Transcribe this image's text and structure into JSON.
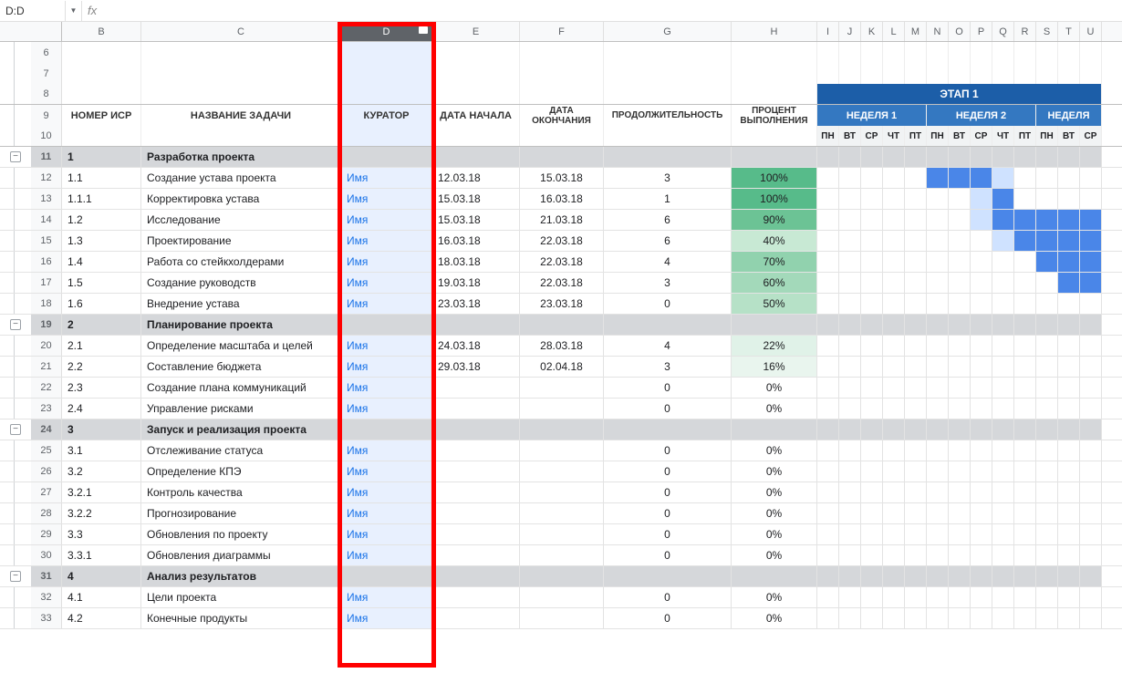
{
  "name_box": "D:D",
  "fx_label": "fx",
  "columns": [
    "B",
    "C",
    "D",
    "E",
    "F",
    "G",
    "H",
    "I",
    "J",
    "K",
    "L",
    "M",
    "N",
    "O",
    "P",
    "Q",
    "R",
    "S",
    "T",
    "U"
  ],
  "col_widths": [
    "w-b",
    "w-c",
    "w-d",
    "w-e",
    "w-f",
    "w-g",
    "w-h",
    "w-day",
    "w-day",
    "w-day",
    "w-day",
    "w-day",
    "w-day",
    "w-day",
    "w-day",
    "w-day",
    "w-day",
    "w-day",
    "w-day",
    "w-day"
  ],
  "selected_col": "D",
  "headers": {
    "b": "НОМЕР ИСР",
    "c": "НАЗВАНИЕ ЗАДАЧИ",
    "d": "КУРАТОР",
    "e": "ДАТА НАЧАЛА",
    "f": "ДАТА ОКОНЧАНИЯ",
    "g": "ПРОДОЛЖИТЕЛЬНОСТЬ",
    "h": "ПРОЦЕНТ ВЫПОЛНЕНИЯ",
    "stage": "ЭТАП 1",
    "week1": "НЕДЕЛЯ 1",
    "week2": "НЕДЕЛЯ 2",
    "week3": "НЕДЕЛЯ",
    "days": [
      "ПН",
      "ВТ",
      "СР",
      "ЧТ",
      "ПТ",
      "ПН",
      "ВТ",
      "СР",
      "ЧТ",
      "ПТ",
      "ПН",
      "ВТ",
      "СР"
    ]
  },
  "rows": [
    {
      "n": 6,
      "type": "blank"
    },
    {
      "n": 7,
      "type": "blank"
    },
    {
      "n": 8,
      "type": "header8"
    },
    {
      "n": 9,
      "type": "header9"
    },
    {
      "n": 10,
      "type": "header10"
    },
    {
      "n": 11,
      "type": "section",
      "wbs": "1",
      "title": "Разработка проекта",
      "toggle": true
    },
    {
      "n": 12,
      "type": "task",
      "wbs": "1.1",
      "title": "Создание устава проекта",
      "cur": "Имя",
      "start": "12.03.18",
      "end": "15.03.18",
      "dur": "3",
      "pct": "100%",
      "pcls": "g100",
      "gantt": [
        0,
        0,
        0,
        0,
        0,
        2,
        2,
        2,
        1,
        0,
        0,
        0,
        0
      ]
    },
    {
      "n": 13,
      "type": "task",
      "wbs": "1.1.1",
      "title": "Корректировка устава",
      "cur": "Имя",
      "start": "15.03.18",
      "end": "16.03.18",
      "dur": "1",
      "pct": "100%",
      "pcls": "g100",
      "gantt": [
        0,
        0,
        0,
        0,
        0,
        0,
        0,
        1,
        2,
        0,
        0,
        0,
        0
      ]
    },
    {
      "n": 14,
      "type": "task",
      "wbs": "1.2",
      "title": "Исследование",
      "cur": "Имя",
      "start": "15.03.18",
      "end": "21.03.18",
      "dur": "6",
      "pct": "90%",
      "pcls": "g90",
      "gantt": [
        0,
        0,
        0,
        0,
        0,
        0,
        0,
        1,
        2,
        2,
        2,
        2,
        2
      ]
    },
    {
      "n": 15,
      "type": "task",
      "wbs": "1.3",
      "title": "Проектирование",
      "cur": "Имя",
      "start": "16.03.18",
      "end": "22.03.18",
      "dur": "6",
      "pct": "40%",
      "pcls": "g40",
      "gantt": [
        0,
        0,
        0,
        0,
        0,
        0,
        0,
        0,
        1,
        2,
        2,
        2,
        2
      ]
    },
    {
      "n": 16,
      "type": "task",
      "wbs": "1.4",
      "title": "Работа со стейкхолдерами",
      "cur": "Имя",
      "start": "18.03.18",
      "end": "22.03.18",
      "dur": "4",
      "pct": "70%",
      "pcls": "g70",
      "gantt": [
        0,
        0,
        0,
        0,
        0,
        0,
        0,
        0,
        0,
        0,
        2,
        2,
        2
      ]
    },
    {
      "n": 17,
      "type": "task",
      "wbs": "1.5",
      "title": "Создание руководств",
      "cur": "Имя",
      "start": "19.03.18",
      "end": "22.03.18",
      "dur": "3",
      "pct": "60%",
      "pcls": "g60",
      "gantt": [
        0,
        0,
        0,
        0,
        0,
        0,
        0,
        0,
        0,
        0,
        0,
        2,
        2
      ]
    },
    {
      "n": 18,
      "type": "task",
      "wbs": "1.6",
      "title": "Внедрение устава",
      "cur": "Имя",
      "start": "23.03.18",
      "end": "23.03.18",
      "dur": "0",
      "pct": "50%",
      "pcls": "g50",
      "gantt": [
        0,
        0,
        0,
        0,
        0,
        0,
        0,
        0,
        0,
        0,
        0,
        0,
        0
      ]
    },
    {
      "n": 19,
      "type": "section",
      "wbs": "2",
      "title": "Планирование проекта",
      "toggle": true
    },
    {
      "n": 20,
      "type": "task",
      "wbs": "2.1",
      "title": "Определение масштаба и целей",
      "cur": "Имя",
      "start": "24.03.18",
      "end": "28.03.18",
      "dur": "4",
      "pct": "22%",
      "pcls": "g22",
      "gantt": [
        0,
        0,
        0,
        0,
        0,
        0,
        0,
        0,
        0,
        0,
        0,
        0,
        0
      ]
    },
    {
      "n": 21,
      "type": "task",
      "wbs": "2.2",
      "title": "Составление бюджета",
      "cur": "Имя",
      "start": "29.03.18",
      "end": "02.04.18",
      "dur": "3",
      "pct": "16%",
      "pcls": "g16",
      "gantt": [
        0,
        0,
        0,
        0,
        0,
        0,
        0,
        0,
        0,
        0,
        0,
        0,
        0
      ]
    },
    {
      "n": 22,
      "type": "task",
      "wbs": "2.3",
      "title": "Создание плана коммуникаций",
      "cur": "Имя",
      "start": "",
      "end": "",
      "dur": "0",
      "pct": "0%",
      "pcls": "",
      "gantt": [
        0,
        0,
        0,
        0,
        0,
        0,
        0,
        0,
        0,
        0,
        0,
        0,
        0
      ]
    },
    {
      "n": 23,
      "type": "task",
      "wbs": "2.4",
      "title": "Управление рисками",
      "cur": "Имя",
      "start": "",
      "end": "",
      "dur": "0",
      "pct": "0%",
      "pcls": "",
      "gantt": [
        0,
        0,
        0,
        0,
        0,
        0,
        0,
        0,
        0,
        0,
        0,
        0,
        0
      ]
    },
    {
      "n": 24,
      "type": "section",
      "wbs": "3",
      "title": "Запуск и реализация проекта",
      "toggle": true
    },
    {
      "n": 25,
      "type": "task",
      "wbs": "3.1",
      "title": "Отслеживание статуса",
      "cur": "Имя",
      "start": "",
      "end": "",
      "dur": "0",
      "pct": "0%",
      "pcls": "",
      "gantt": [
        0,
        0,
        0,
        0,
        0,
        0,
        0,
        0,
        0,
        0,
        0,
        0,
        0
      ]
    },
    {
      "n": 26,
      "type": "task",
      "wbs": "3.2",
      "title": "Определение КПЭ",
      "cur": "Имя",
      "start": "",
      "end": "",
      "dur": "0",
      "pct": "0%",
      "pcls": "",
      "gantt": [
        0,
        0,
        0,
        0,
        0,
        0,
        0,
        0,
        0,
        0,
        0,
        0,
        0
      ]
    },
    {
      "n": 27,
      "type": "task",
      "wbs": "3.2.1",
      "title": "Контроль качества",
      "cur": "Имя",
      "start": "",
      "end": "",
      "dur": "0",
      "pct": "0%",
      "pcls": "",
      "gantt": [
        0,
        0,
        0,
        0,
        0,
        0,
        0,
        0,
        0,
        0,
        0,
        0,
        0
      ]
    },
    {
      "n": 28,
      "type": "task",
      "wbs": "3.2.2",
      "title": "Прогнозирование",
      "cur": "Имя",
      "start": "",
      "end": "",
      "dur": "0",
      "pct": "0%",
      "pcls": "",
      "gantt": [
        0,
        0,
        0,
        0,
        0,
        0,
        0,
        0,
        0,
        0,
        0,
        0,
        0
      ]
    },
    {
      "n": 29,
      "type": "task",
      "wbs": "3.3",
      "title": "Обновления по проекту",
      "cur": "Имя",
      "start": "",
      "end": "",
      "dur": "0",
      "pct": "0%",
      "pcls": "",
      "gantt": [
        0,
        0,
        0,
        0,
        0,
        0,
        0,
        0,
        0,
        0,
        0,
        0,
        0
      ]
    },
    {
      "n": 30,
      "type": "task",
      "wbs": "3.3.1",
      "title": "Обновления диаграммы",
      "cur": "Имя",
      "start": "",
      "end": "",
      "dur": "0",
      "pct": "0%",
      "pcls": "",
      "gantt": [
        0,
        0,
        0,
        0,
        0,
        0,
        0,
        0,
        0,
        0,
        0,
        0,
        0
      ]
    },
    {
      "n": 31,
      "type": "section",
      "wbs": "4",
      "title": "Анализ результатов",
      "toggle": true
    },
    {
      "n": 32,
      "type": "task",
      "wbs": "4.1",
      "title": "Цели проекта",
      "cur": "Имя",
      "start": "",
      "end": "",
      "dur": "0",
      "pct": "0%",
      "pcls": "",
      "gantt": [
        0,
        0,
        0,
        0,
        0,
        0,
        0,
        0,
        0,
        0,
        0,
        0,
        0
      ]
    },
    {
      "n": 33,
      "type": "task",
      "wbs": "4.2",
      "title": "Конечные продукты",
      "cur": "Имя",
      "start": "",
      "end": "",
      "dur": "0",
      "pct": "0%",
      "pcls": "",
      "gantt": [
        0,
        0,
        0,
        0,
        0,
        0,
        0,
        0,
        0,
        0,
        0,
        0,
        0
      ]
    }
  ]
}
